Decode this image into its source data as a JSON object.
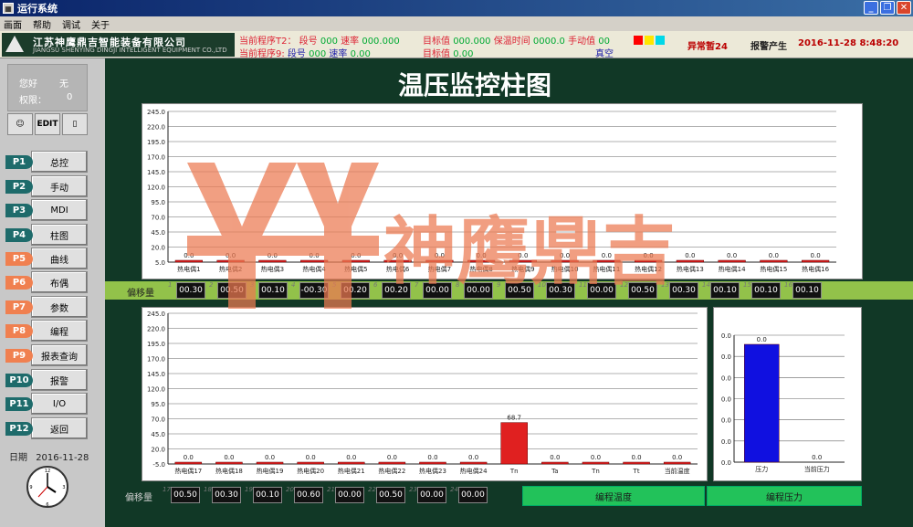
{
  "window": {
    "title": "运行系统"
  },
  "menu": [
    "画面",
    "帮助",
    "调试",
    "关于"
  ],
  "logo": {
    "name_cn": "江苏神鹰鼎吉智能装备有限公司",
    "name_en": "JIANGSU SHENYING DINGJI INTELLIGENT EQUIPMENT CO.,LTD"
  },
  "header": {
    "program_label": "当前程序T2：",
    "seg_label": "段号",
    "seg_value": "000",
    "speed_label": "速率",
    "speed_value": "000.000",
    "target_label": "目标值",
    "target_value": "000.000",
    "hold_label": "保温时间",
    "hold_value": "0000.0",
    "control_label": "手动值",
    "control_value": "00",
    "program2_label": "当前程序9:",
    "seg2_label": "段号",
    "seg2_value": "000",
    "speed2_label": "速率",
    "speed2_value": "0.00",
    "target2_label": "目标值",
    "target2_value": "0.00",
    "vacuum_label": "真空",
    "status_alarm": "异常暂24",
    "alarm_text": "报警产生",
    "datetime": "2016-11-28  8:48:20",
    "status_colors": [
      "#ff0000",
      "#ffe600",
      "#00d8e8"
    ]
  },
  "user": {
    "user_label": "您好",
    "user_value": "无",
    "perm_label": "权限：",
    "perm_value": "0"
  },
  "toolbar": {
    "edit_label": "EDIT"
  },
  "nav": [
    {
      "tag": "P1",
      "label": "总控",
      "orange": false
    },
    {
      "tag": "P2",
      "label": "手动",
      "orange": false
    },
    {
      "tag": "P3",
      "label": "MDI",
      "orange": false
    },
    {
      "tag": "P4",
      "label": "柱图",
      "orange": false
    },
    {
      "tag": "P5",
      "label": "曲线",
      "orange": true
    },
    {
      "tag": "P6",
      "label": "布偶",
      "orange": true
    },
    {
      "tag": "P7",
      "label": "参数",
      "orange": true
    },
    {
      "tag": "P8",
      "label": "编程",
      "orange": true
    },
    {
      "tag": "P9",
      "label": "报表查询",
      "orange": true
    },
    {
      "tag": "P10",
      "label": "报警",
      "orange": false
    },
    {
      "tag": "P11",
      "label": "I/O",
      "orange": false
    },
    {
      "tag": "P12",
      "label": "返回",
      "orange": false
    }
  ],
  "footer": {
    "date_label": "日期",
    "date_value": "2016-11-28"
  },
  "page": {
    "title": "温压监控柱图",
    "offset_label": "偏移量",
    "offset_label2": "偏移量",
    "btn_temp": "编程温度",
    "btn_pressure": "编程压力"
  },
  "watermark": {
    "text": "神鹰鼎吉"
  },
  "offsets_top": [
    "00.30",
    "00.50",
    "00.10",
    "-00.30",
    "00.20",
    "00.20",
    "00.00",
    "00.00",
    "00.50",
    "00.30",
    "00.00",
    "00.50",
    "00.30",
    "00.10",
    "00.10",
    "00.10"
  ],
  "offsets_bottom": [
    "00.50",
    "00.30",
    "00.10",
    "00.60",
    "00.00",
    "00.50",
    "00.00",
    "00.00"
  ],
  "offset_indices_top": [
    "1",
    "2",
    "3",
    "4",
    "5",
    "6",
    "7",
    "8",
    "9",
    "10",
    "11",
    "12",
    "13",
    "14",
    "15",
    "16"
  ],
  "offset_indices_bottom": [
    "17",
    "18",
    "19",
    "20",
    "21",
    "22",
    "23",
    "24"
  ],
  "chart_data": [
    {
      "type": "bar",
      "categories": [
        "热电偶1",
        "热电偶2",
        "热电偶3",
        "热电偶4",
        "热电偶5",
        "热电偶6",
        "热电偶7",
        "热电偶8",
        "热电偶9",
        "热电偶10",
        "热电偶11",
        "热电偶12",
        "热电偶13",
        "热电偶14",
        "热电偶15",
        "热电偶16"
      ],
      "values": [
        0,
        0,
        0,
        0,
        0,
        0,
        0,
        0,
        0,
        0,
        0,
        0,
        0,
        0,
        0,
        0
      ],
      "value_labels": [
        "0.0",
        "0.0",
        "0.0",
        "0.0",
        "0.0",
        "0.0",
        "0.0",
        "0.0",
        "0.0",
        "0.0",
        "0.0",
        "0.0",
        "0.0",
        "0.0",
        "0.0",
        "0.0"
      ],
      "yticks": [
        "5.0",
        "20.0",
        "45.0",
        "70.0",
        "95.0",
        "120.0",
        "145.0",
        "170.0",
        "195.0",
        "220.0",
        "245.0"
      ],
      "ylim": [
        -5,
        245
      ],
      "bar_color": "#e02020"
    },
    {
      "type": "bar",
      "categories": [
        "热电偶17",
        "热电偶18",
        "热电偶19",
        "热电偶20",
        "热电偶21",
        "热电偶22",
        "热电偶23",
        "热电偶24",
        "Tn",
        "Ta",
        "Tn",
        "Tt",
        "当前温度"
      ],
      "values": [
        0,
        0,
        0,
        0,
        0,
        0,
        0,
        0,
        68.7,
        0,
        0,
        0,
        0
      ],
      "value_labels": [
        "0.0",
        "0.0",
        "0.0",
        "0.0",
        "0.0",
        "0.0",
        "0.0",
        "0.0",
        "68.7",
        "0.0",
        "0.0",
        "0.0",
        "0.0"
      ],
      "yticks": [
        "-5.0",
        "20.0",
        "45.0",
        "70.0",
        "95.0",
        "120.0",
        "145.0",
        "170.0",
        "195.0",
        "220.0",
        "245.0"
      ],
      "ylim": [
        -5,
        245
      ],
      "bar_color": "#e02020"
    },
    {
      "type": "bar",
      "categories": [
        "压力",
        "当前压力"
      ],
      "values": [
        0,
        0
      ],
      "value_labels": [
        "0.0",
        "0.0"
      ],
      "yticks": [
        "0.0",
        "0.0",
        "0.0",
        "0.0",
        "0.0",
        "0.0",
        "0.0"
      ],
      "bar_color": "#1010e0",
      "bar_fills": [
        1,
        0
      ]
    }
  ]
}
